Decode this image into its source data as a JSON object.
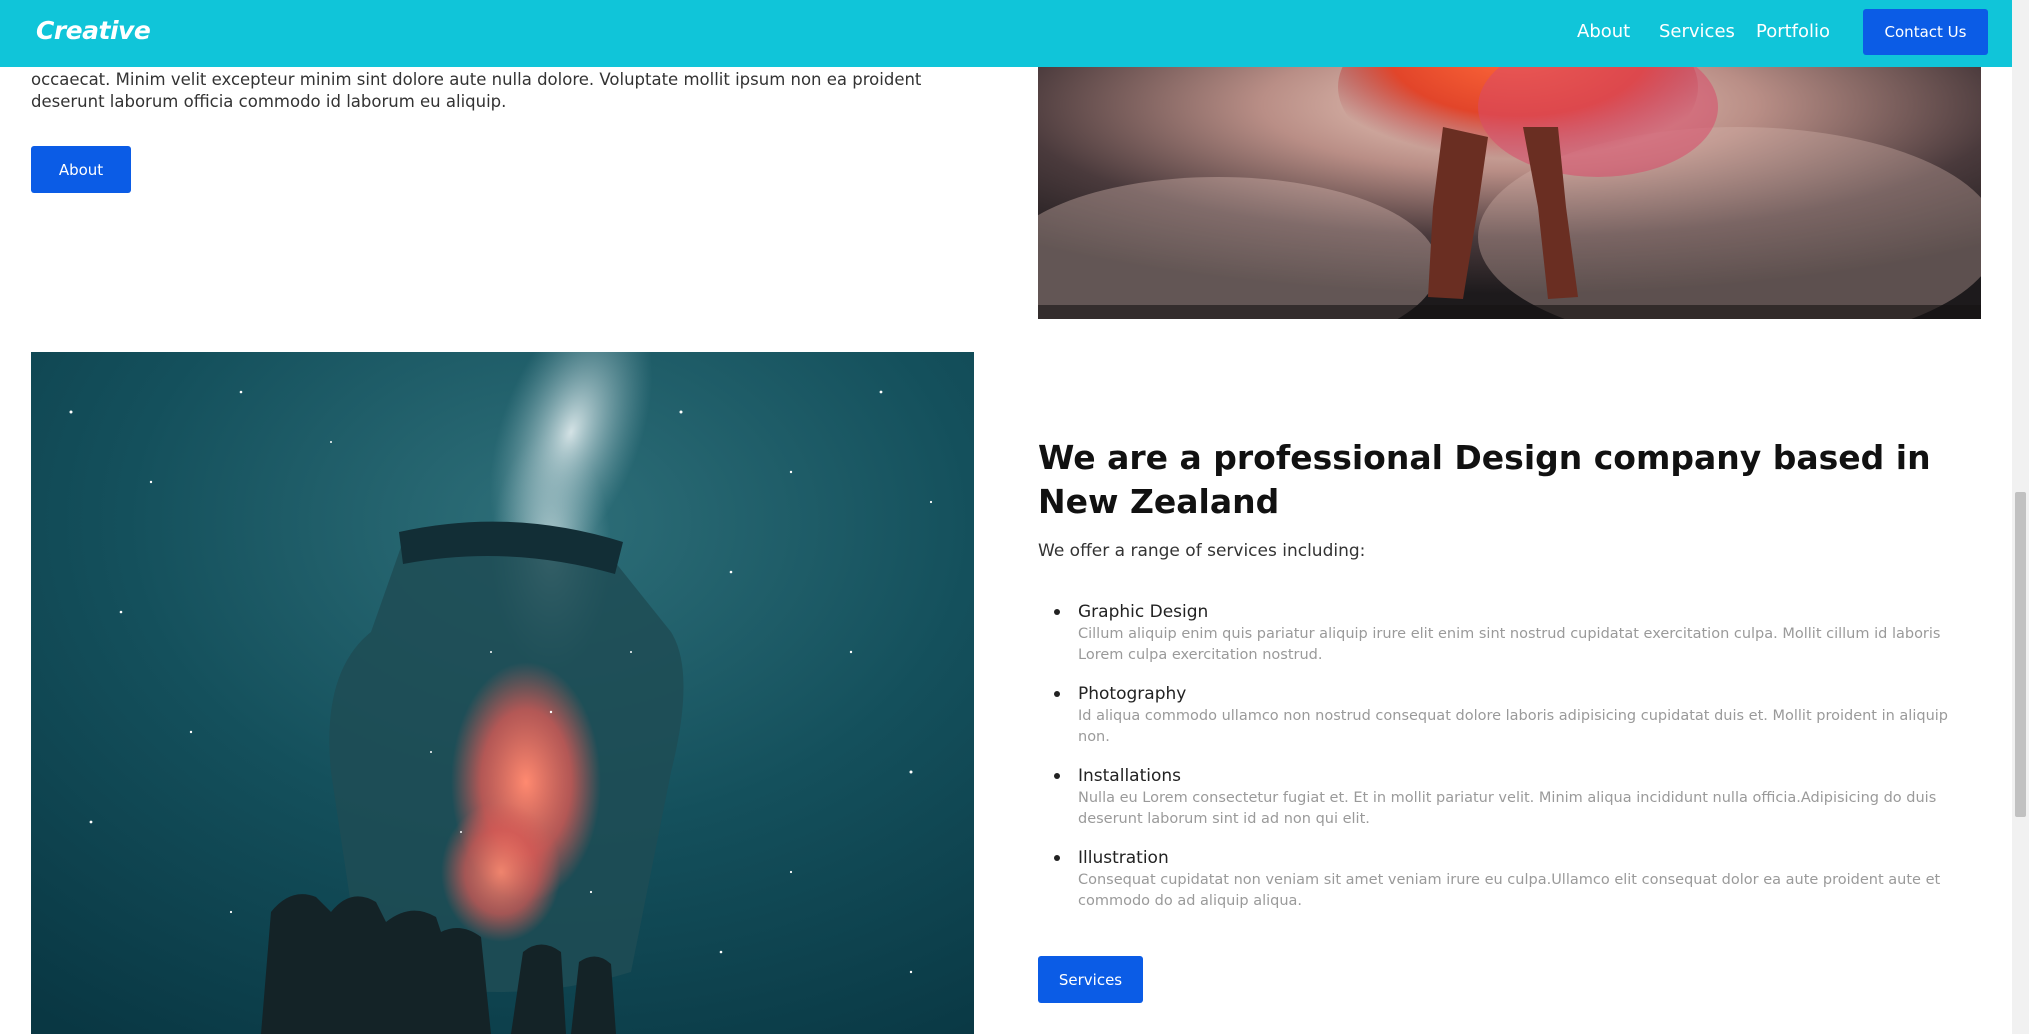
{
  "nav": {
    "brand": "Creative",
    "links": [
      "About",
      "Services",
      "Portfolio"
    ],
    "contact_label": "Contact Us",
    "background": "#10c5d9"
  },
  "intro": {
    "text": "occaecat. Minim velit excepteur minim sint dolore aute nulla dolore. Voluptate mollit ipsum non ea proident deserunt laborum officia commodo id laborum eu aliquip.",
    "button_label": "About"
  },
  "services": {
    "heading": "We are a professional Design company based in New Zealand",
    "intro": "We offer a range of services including:",
    "items": [
      {
        "title": "Graphic Design",
        "desc": "Cillum aliquip enim quis pariatur aliquip irure elit enim sint nostrud cupidatat exercitation culpa. Mollit cillum id laboris Lorem culpa exercitation nostrud."
      },
      {
        "title": "Photography",
        "desc": "Id aliqua commodo ullamco non nostrud consequat dolore laboris adipisicing cupidatat duis et. Mollit proident in aliquip non."
      },
      {
        "title": "Installations",
        "desc": "Nulla eu Lorem consectetur fugiat et. Et in mollit pariatur velit. Minim aliqua incididunt nulla officia.Adipisicing do duis deserunt laborum sint id ad non qui elit."
      },
      {
        "title": "Illustration",
        "desc": "Consequat cupidatat non veniam sit amet veniam irure eu culpa.Ullamco elit consequat dolor ea aute proident aute et commodo do ad aliquip aliqua."
      }
    ],
    "button_label": "Services"
  },
  "colors": {
    "accent": "#0b5ce6",
    "nav": "#10c5d9"
  }
}
